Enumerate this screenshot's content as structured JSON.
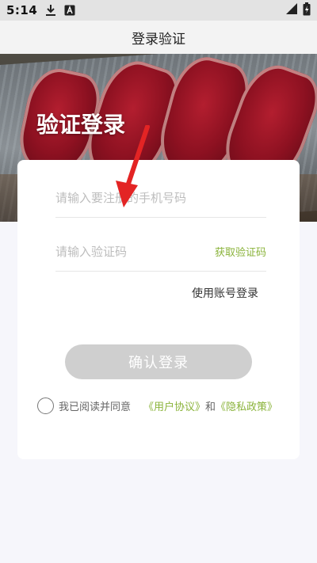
{
  "status_bar": {
    "time": "5:14",
    "icons": [
      "download-icon",
      "text-a-icon",
      "signal-icon",
      "battery-icon"
    ]
  },
  "header": {
    "title": "登录验证"
  },
  "hero": {
    "title": "验证登录"
  },
  "form": {
    "phone_placeholder": "请输入要注册的手机号码",
    "code_placeholder": "请输入验证码",
    "get_code_label": "获取验证码",
    "account_login_label": "使用账号登录",
    "confirm_label": "确认登录"
  },
  "agreement": {
    "prefix": "我已阅读并同意",
    "user_agreement": "《用户协议》",
    "and": "和",
    "privacy_policy": "《隐私政策》"
  },
  "colors": {
    "accent": "#8ab33a",
    "button_disabled": "#cfcfcf",
    "annotation_arrow": "#e32424"
  }
}
